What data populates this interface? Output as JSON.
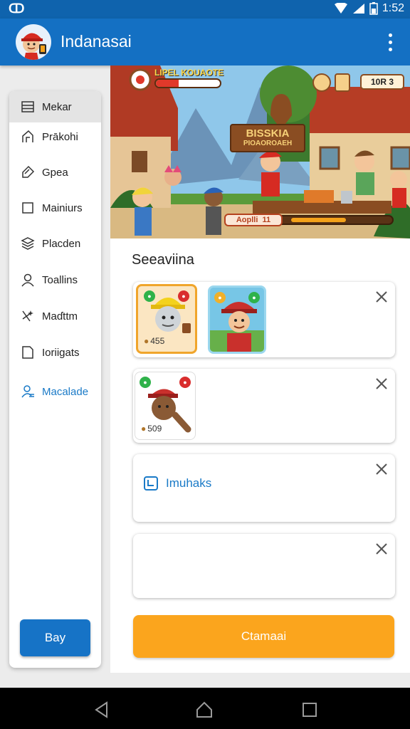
{
  "status": {
    "time": "1:52"
  },
  "app": {
    "title": "Indanasai"
  },
  "drawer": {
    "items": [
      {
        "label": "Mekar",
        "icon": "list-icon"
      },
      {
        "label": "Prākohi",
        "icon": "home-icon"
      },
      {
        "label": "Gpea",
        "icon": "tag-icon"
      },
      {
        "label": "Mainiurs",
        "icon": "square-icon"
      },
      {
        "label": "Placden",
        "icon": "layers-icon"
      },
      {
        "label": "Toallins",
        "icon": "user-icon"
      },
      {
        "label": "Maɗttm",
        "icon": "sparkle-icon"
      },
      {
        "label": "Ioriigats",
        "icon": "file-icon"
      },
      {
        "label": "Macalade",
        "icon": "group-icon"
      }
    ],
    "selected_index": 0,
    "active_index": 8,
    "buy_label": "Bay"
  },
  "hero": {
    "top_label": "LIPEL KOUAOTE",
    "health_level": 0.35,
    "score": "10R 3",
    "sign_line1": "BISSKIA",
    "sign_line2": "PIOAOROAEH",
    "hud_label": "Aoplli",
    "hud_count": "11",
    "hud_progress": 0.55
  },
  "section": {
    "title": "Seeaviina"
  },
  "cards": [
    {
      "items": [
        {
          "price": "455",
          "theme": "yellow"
        },
        {
          "price": "",
          "theme": "lumberjack"
        }
      ]
    },
    {
      "items": [
        {
          "price": "509",
          "theme": "brown"
        }
      ]
    },
    {
      "link_label": "Imuhaks"
    },
    {}
  ],
  "cta": {
    "label": "Ctamaai"
  },
  "colors": {
    "primary": "#1470c3",
    "accent": "#fba51d",
    "link": "#1a7ac7"
  }
}
